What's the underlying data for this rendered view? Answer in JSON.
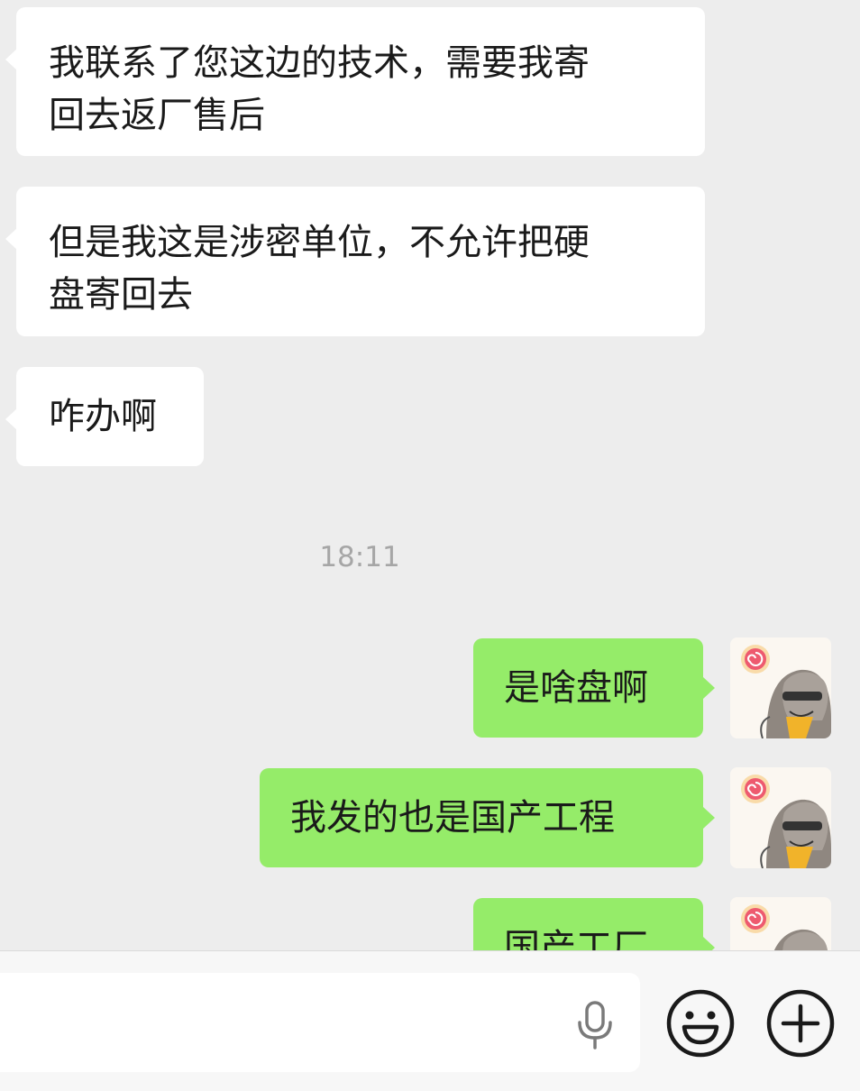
{
  "messages": [
    {
      "side": "incoming",
      "text": "我联系了您这边的技术，需要我寄\n回去返厂售后"
    },
    {
      "side": "incoming",
      "text": "但是我这是涉密单位，不允许把硬\n盘寄回去"
    },
    {
      "side": "incoming",
      "text": "咋办啊"
    },
    {
      "side": "outgoing",
      "text": "是啥盘啊"
    },
    {
      "side": "outgoing",
      "text": "我发的也是国产工程"
    },
    {
      "side": "outgoing",
      "text": "国产工厂"
    }
  ],
  "timestamp": "18:11",
  "colors": {
    "background": "#ededed",
    "incoming_bubble": "#ffffff",
    "outgoing_bubble": "#95ec69",
    "timestamp_text": "#a6a6a6"
  },
  "input_bar": {
    "icons": [
      "microphone-icon",
      "emoji-icon",
      "plus-icon"
    ]
  }
}
